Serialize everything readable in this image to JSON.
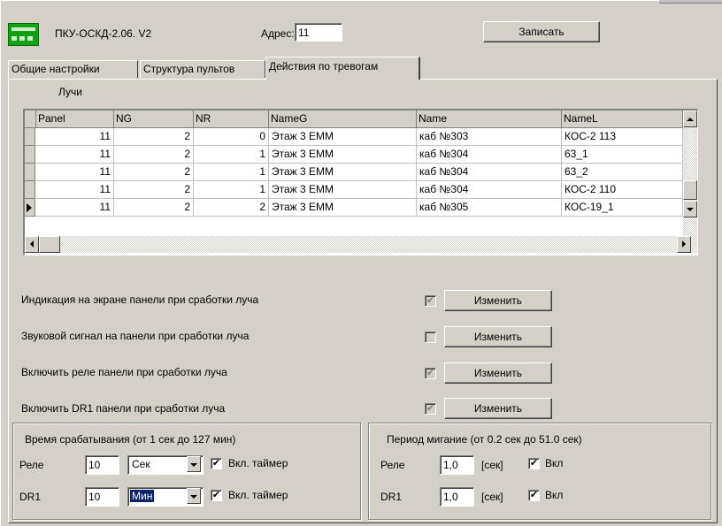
{
  "header": {
    "device_title": "ПКУ-ОСКД-2.06. V2",
    "address_label": "Адрес:",
    "address_value": "11",
    "write_button": "Записать"
  },
  "tabs": [
    {
      "label": "Общие настройки",
      "active": false
    },
    {
      "label": "Структура пультов",
      "active": false
    },
    {
      "label": "Действия по тревогам",
      "active": true
    }
  ],
  "rays_label": "Лучи",
  "grid": {
    "columns": [
      "Panel",
      "NG",
      "NR",
      "NameG",
      "Name",
      "NameL"
    ],
    "rows": [
      [
        "11",
        "2",
        "0",
        "Этаж 3 ЕММ",
        "каб №303",
        "КОС-2 113"
      ],
      [
        "11",
        "2",
        "1",
        "Этаж 3 ЕММ",
        "каб №304",
        "63_1"
      ],
      [
        "11",
        "2",
        "1",
        "Этаж 3 ЕММ",
        "каб №304",
        "63_2"
      ],
      [
        "11",
        "2",
        "1",
        "Этаж 3 ЕММ",
        "каб №304",
        "КОС-2 110"
      ],
      [
        "11",
        "2",
        "2",
        "Этаж 3 ЕММ",
        "каб №305",
        "КОС-19_1"
      ]
    ],
    "current_row": 5
  },
  "options": [
    {
      "label": "Индикация на экране панели при сработки луча",
      "checked": true,
      "button": "Изменить"
    },
    {
      "label": "Звуковой сигнал на панели при сработки луча",
      "checked": false,
      "button": "Изменить"
    },
    {
      "label": "Включить реле панели при сработки луча",
      "checked": true,
      "button": "Изменить"
    },
    {
      "label": "Включить DR1 панели при сработки луча",
      "checked": true,
      "button": "Изменить"
    }
  ],
  "trigger_group": {
    "title": "Время срабатывания (от 1 сек до 127 мин)",
    "rows": [
      {
        "label": "Реле",
        "value": "10",
        "unit": "Сек",
        "timer_label": "Вкл. таймер",
        "timer_checked": true
      },
      {
        "label": "DR1",
        "value": "10",
        "unit": "Мин",
        "timer_label": "Вкл. таймер",
        "timer_checked": true
      }
    ]
  },
  "blink_group": {
    "title": "Период мигание (от 0.2 сек до 51.0 сек)",
    "rows": [
      {
        "label": "Реле",
        "value": "1,0",
        "unit": "[сек]",
        "enable_label": "Вкл",
        "checked": true
      },
      {
        "label": "DR1",
        "value": "1,0",
        "unit": "[сек]",
        "enable_label": "Вкл",
        "checked": true
      }
    ]
  },
  "check_mark": "✔",
  "colors": {
    "face": "#d4d0c8",
    "selection": "#0a246a",
    "device_icon": "#14a014"
  }
}
